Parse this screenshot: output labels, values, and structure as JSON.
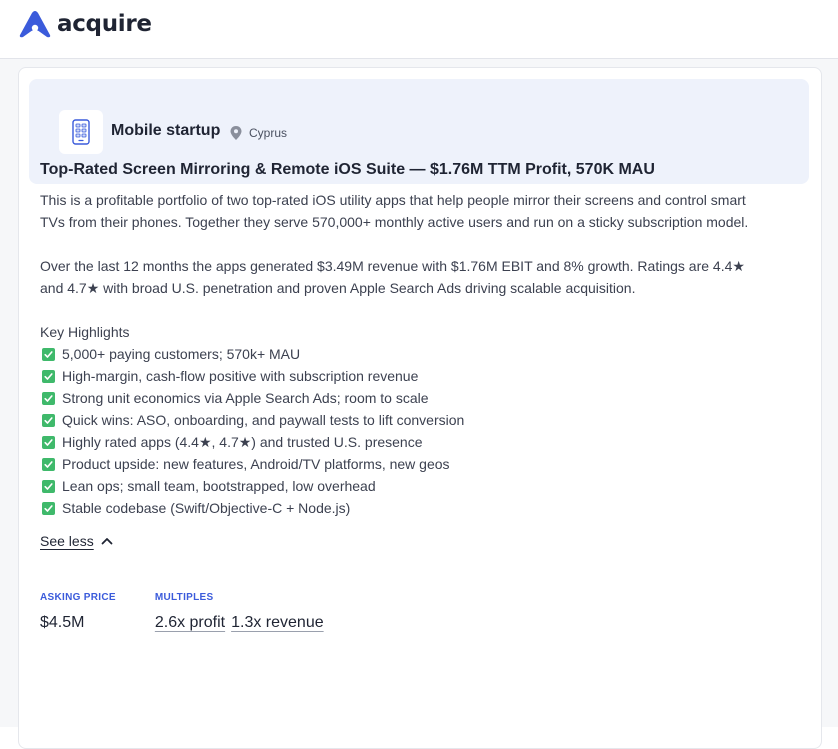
{
  "header": {
    "brand": "acquire"
  },
  "listing": {
    "category": "Mobile startup",
    "location": "Cyprus",
    "title": "Top-Rated Screen Mirroring & Remote iOS Suite — $1.76M TTM Profit, 570K MAU",
    "paragraphs": [
      "This is a profitable portfolio of two top-rated iOS utility apps that help people mirror their screens and control smart TVs from their phones. Together they serve 570,000+ monthly active users and run on a sticky subscription model.",
      "Over the last 12 months the apps generated $3.49M revenue with $1.76M EBIT and 8% growth. Ratings are 4.4★ and 4.7★ with broad U.S. penetration and proven Apple Search Ads driving scalable acquisition."
    ],
    "highlights_heading": "Key Highlights",
    "highlights": [
      "5,000+ paying customers; 570k+ MAU",
      "High-margin, cash-flow positive with subscription revenue",
      "Strong unit economics via Apple Search Ads; room to scale",
      "Quick wins: ASO, onboarding, and paywall tests to lift conversion",
      "Highly rated apps (4.4★, 4.7★) and trusted U.S. presence",
      "Product upside: new features, Android/TV platforms, new geos",
      "Lean ops; small team, bootstrapped, low overhead",
      "Stable codebase (Swift/Objective-C + Node.js)"
    ],
    "see_less_label": "See less"
  },
  "metrics": {
    "asking_price_label": "ASKING PRICE",
    "asking_price_value": "$4.5M",
    "multiples_label": "MULTIPLES",
    "profit_multiple": "2.6x profit",
    "revenue_multiple": "1.3x revenue"
  },
  "colors": {
    "brand": "#3b5bdb",
    "check": "#3fb96b",
    "head_bg": "#eef2fb",
    "text": "#1f2433"
  },
  "icons": [
    "acquire-logo-icon",
    "mobile-device-icon",
    "location-pin-icon",
    "checkmark-icon",
    "chevron-up-icon"
  ]
}
